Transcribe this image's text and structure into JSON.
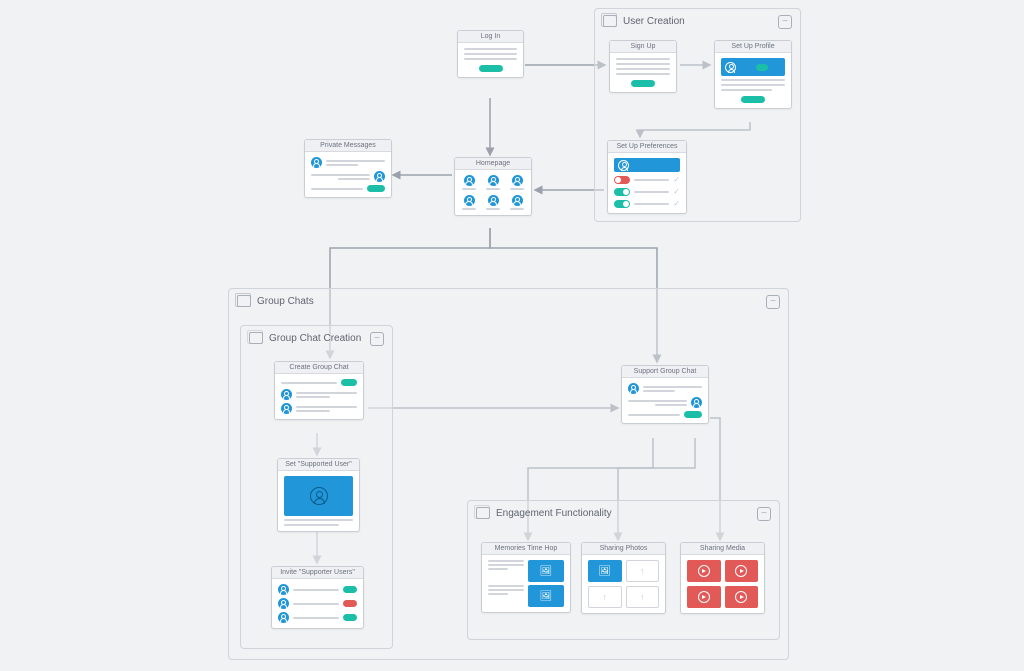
{
  "cards": {
    "login": "Log In",
    "homepage": "Homepage",
    "private_messages": "Private Messages",
    "signup": "Sign Up",
    "profile": "Set Up Profile",
    "preferences": "Set Up Preferences",
    "create_group": "Create Group Chat",
    "set_supported": "Set \"Supported User\"",
    "invite_supporter": "Invite \"Supporter Users\"",
    "support_group": "Support Group Chat",
    "memories": "Memories Time Hop",
    "sharing_photos": "Sharing Photos",
    "sharing_media": "Sharing Media"
  },
  "groups": {
    "user_creation": "User Creation",
    "group_chats": "Group Chats",
    "group_chat_creation": "Group Chat Creation",
    "engagement": "Engagement Functionality"
  },
  "colors": {
    "blue": "#2196d8",
    "teal": "#1bbfa8",
    "red": "#e25a58",
    "border": "#cfd4da"
  }
}
